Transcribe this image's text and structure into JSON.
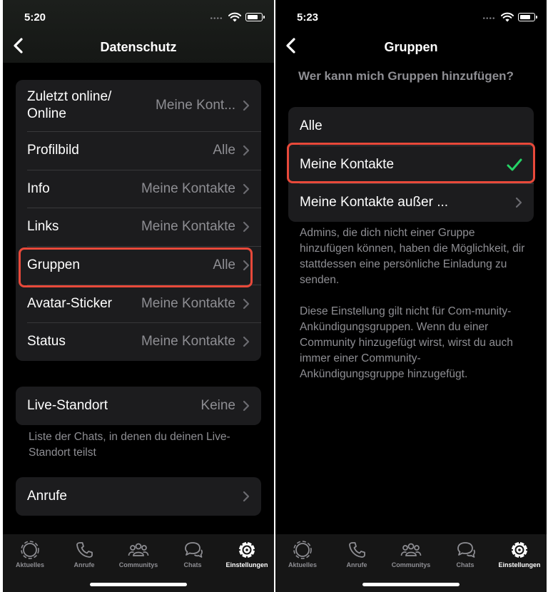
{
  "left": {
    "status_time": "5:20",
    "title": "Datenschutz",
    "rows": [
      {
        "label": "Zuletzt online/\nOnline",
        "value": "Meine Kont..."
      },
      {
        "label": "Profilbild",
        "value": "Alle"
      },
      {
        "label": "Info",
        "value": "Meine Kontakte"
      },
      {
        "label": "Links",
        "value": "Meine Kontakte"
      },
      {
        "label": "Gruppen",
        "value": "Alle"
      },
      {
        "label": "Avatar-Sticker",
        "value": "Meine Kontakte"
      },
      {
        "label": "Status",
        "value": "Meine Kontakte"
      }
    ],
    "live": {
      "label": "Live-Standort",
      "value": "Keine"
    },
    "live_footnote": "Liste der Chats, in denen du deinen Live-Standort teilst",
    "calls": {
      "label": "Anrufe"
    }
  },
  "right": {
    "status_time": "5:23",
    "title": "Gruppen",
    "question": "Wer kann mich Gruppen hinzufügen?",
    "options": [
      {
        "label": "Alle"
      },
      {
        "label": "Meine Kontakte",
        "selected": true
      },
      {
        "label": "Meine Kontakte außer ..."
      }
    ],
    "footnote_1": "Admins, die dich nicht einer Gruppe hinzufügen können, haben die Möglichkeit, dir stattdessen eine persönliche Einladung zu senden.",
    "footnote_2": "Diese Einstellung gilt nicht für Com-munity-Ankündigungsgruppen. Wenn du einer Community hinzugefügt wirst, wirst du auch immer einer Community-Ankündigungsgruppe hinzugefügt."
  },
  "tabs": [
    {
      "label": "Aktuelles",
      "icon": "status-icon"
    },
    {
      "label": "Anrufe",
      "icon": "phone-icon"
    },
    {
      "label": "Communitys",
      "icon": "communities-icon"
    },
    {
      "label": "Chats",
      "icon": "chats-icon"
    },
    {
      "label": "Einstellungen",
      "icon": "settings-gear-icon",
      "active": true
    }
  ],
  "colors": {
    "accent_check": "#25d366",
    "highlight": "#e8493a",
    "cell_bg": "#1c1c1e"
  }
}
